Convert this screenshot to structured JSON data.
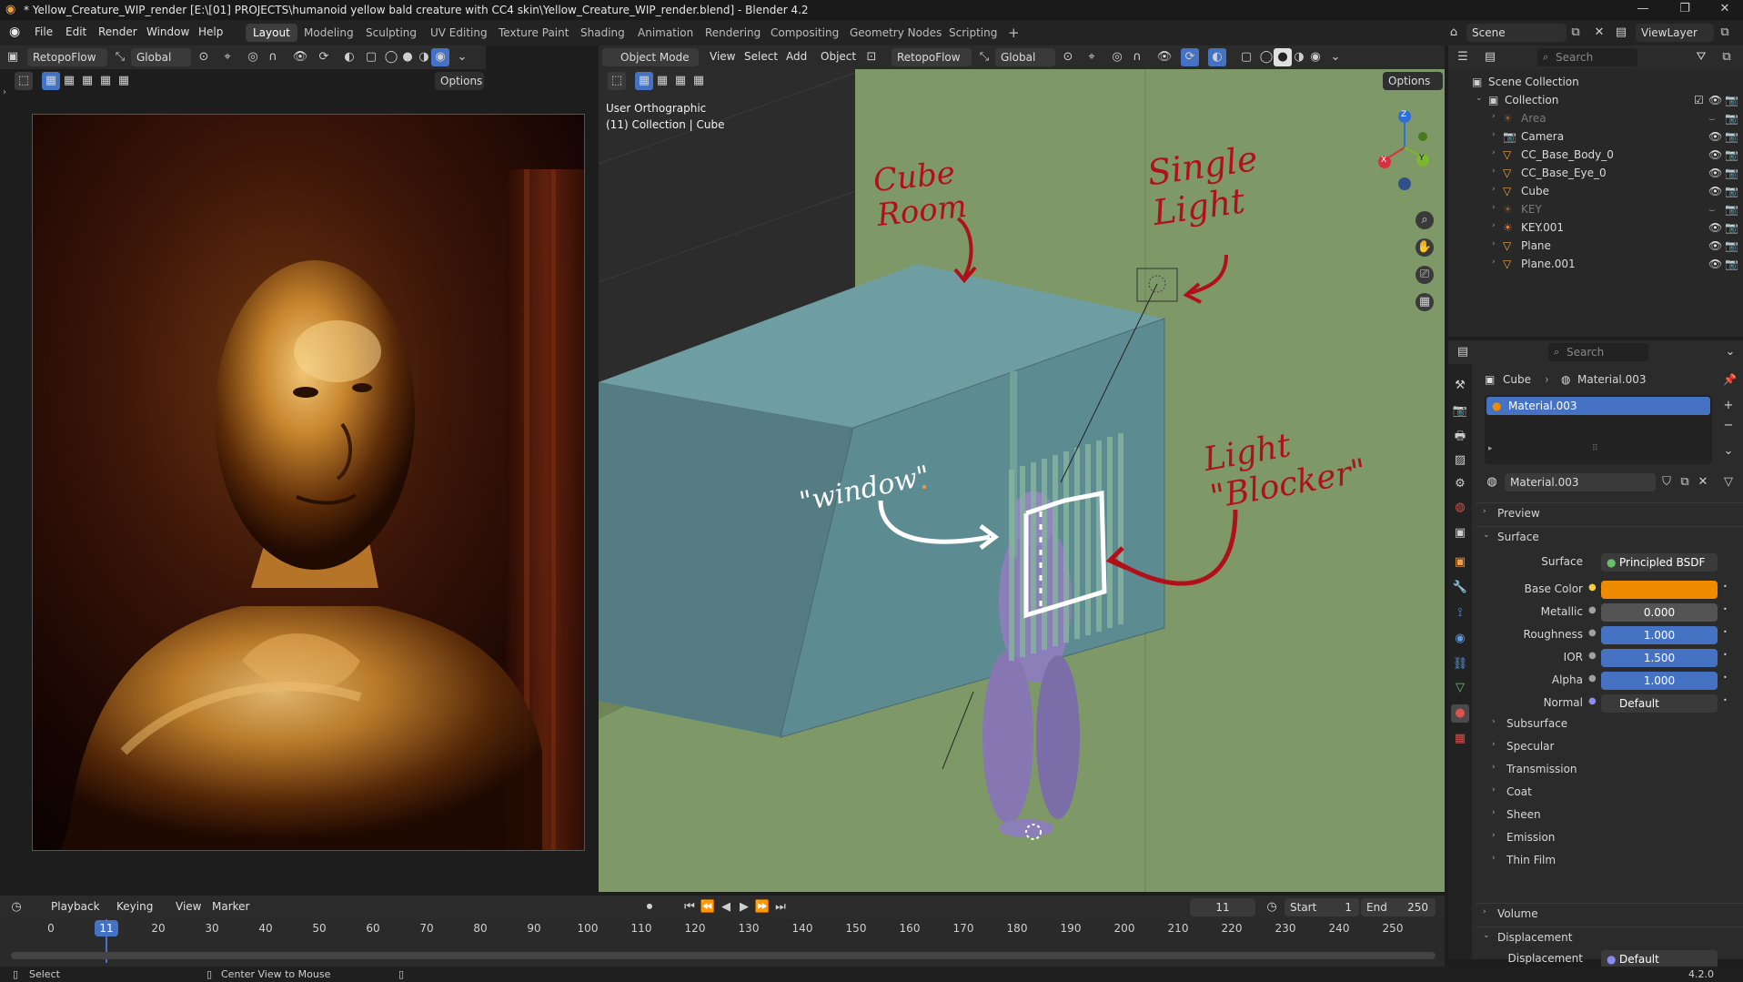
{
  "window": {
    "title": "* Yellow_Creature_WIP_render [E:\\[01] PROJECTS\\humanoid yellow bald creature with CC4 skin\\Yellow_Creature_WIP_render.blend] - Blender 4.2"
  },
  "menu": [
    "File",
    "Edit",
    "Render",
    "Window",
    "Help"
  ],
  "workspaces": [
    "Layout",
    "Modeling",
    "Sculpting",
    "UV Editing",
    "Texture Paint",
    "Shading",
    "Animation",
    "Rendering",
    "Compositing",
    "Geometry Nodes",
    "Scripting"
  ],
  "active_workspace": "Layout",
  "scene": {
    "name": "Scene",
    "view_layer": "ViewLayer"
  },
  "image_editor": {
    "addon": "RetopoFlow",
    "transform": "Global",
    "options": "Options"
  },
  "viewport": {
    "mode": "Object Mode",
    "menus": [
      "View",
      "Select",
      "Add",
      "Object"
    ],
    "addon": "RetopoFlow",
    "transform": "Global",
    "options": "Options",
    "overlay_view": "User Orthographic",
    "overlay_collection": "(11) Collection | Cube",
    "gizmo": {
      "x": "X",
      "y": "Y",
      "z": "Z"
    },
    "annotations": {
      "cube_room": "Cube\nRoom",
      "single_light": "Single\nLight",
      "window": "\"window\"",
      "light_blocker": "Light\n\"Blocker\""
    }
  },
  "outliner": {
    "search_placeholder": "Search",
    "root": "Scene Collection",
    "collection": "Collection",
    "items": [
      "Area",
      "Camera",
      "CC_Base_Body_0",
      "CC_Base_Eye_0",
      "Cube",
      "KEY",
      "KEY.001",
      "Plane",
      "Plane.001"
    ]
  },
  "properties": {
    "search_placeholder": "Search",
    "breadcrumb_object": "Cube",
    "breadcrumb_material": "Material.003",
    "slot": "Material.003",
    "material_name": "Material.003",
    "panels": {
      "preview": "Preview",
      "surface": "Surface"
    },
    "surface_label": "Surface",
    "surface_shader": "Principled BSDF",
    "fields": [
      {
        "label": "Base Color",
        "value": ""
      },
      {
        "label": "Metallic",
        "value": "0.000"
      },
      {
        "label": "Roughness",
        "value": "1.000"
      },
      {
        "label": "IOR",
        "value": "1.500"
      },
      {
        "label": "Alpha",
        "value": "1.000"
      },
      {
        "label": "Normal",
        "value": "Default"
      }
    ],
    "subpanels": [
      "Subsurface",
      "Specular",
      "Transmission",
      "Coat",
      "Sheen",
      "Emission",
      "Thin Film"
    ],
    "volume": "Volume",
    "displacement_panel": "Displacement",
    "displacement_label": "Displacement",
    "displacement_value": "Default",
    "base_color_hex": "#f08a00"
  },
  "timeline": {
    "menus": [
      "Playback",
      "Keying",
      "View",
      "Marker"
    ],
    "current_frame": "11",
    "start_label": "Start",
    "start": "1",
    "end_label": "End",
    "end": "250",
    "ticks": [
      "0",
      "10",
      "20",
      "30",
      "40",
      "50",
      "60",
      "70",
      "80",
      "90",
      "100",
      "110",
      "120",
      "130",
      "140",
      "150",
      "160",
      "170",
      "180",
      "190",
      "200",
      "210",
      "220",
      "230",
      "240",
      "250"
    ]
  },
  "status": {
    "select": "Select",
    "center": "Center View to Mouse",
    "version": "4.2.0"
  }
}
